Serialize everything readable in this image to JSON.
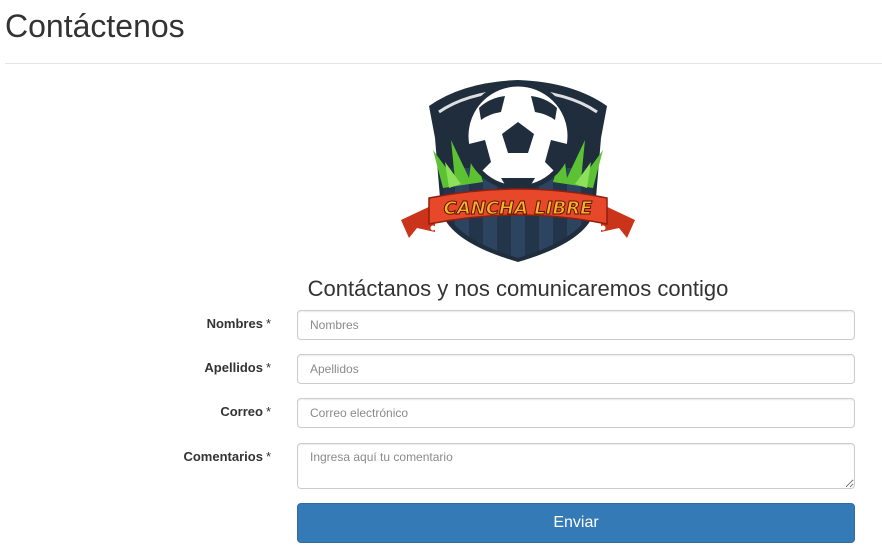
{
  "page": {
    "title": "Contáctenos"
  },
  "logo": {
    "text": "CANCHA LIBRE",
    "colors": {
      "shield": "#1f2d3d",
      "ribbon": "#e8482a",
      "ribbon_text": "#f5b324",
      "grass": "#5cc234"
    }
  },
  "form": {
    "heading": "Contáctanos y nos comunicaremos contigo",
    "required_marker": "*",
    "fields": [
      {
        "label": "Nombres",
        "placeholder": "Nombres",
        "value": ""
      },
      {
        "label": "Apellidos",
        "placeholder": "Apellidos",
        "value": ""
      },
      {
        "label": "Correo",
        "placeholder": "Correo electrónico",
        "value": ""
      },
      {
        "label": "Comentarios",
        "placeholder": "Ingresa aquí tu comentario",
        "value": ""
      }
    ],
    "submit_label": "Enviar",
    "submit_color": "#337ab7"
  }
}
